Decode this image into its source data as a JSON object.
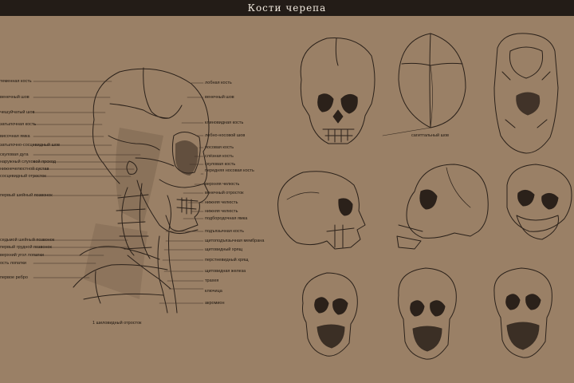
{
  "title": "Кости черепа",
  "labels_left": [
    "теменная кость",
    "венечный шов",
    "чешуйчатый шов",
    "затылочная кость",
    "височная ямка",
    "затылочно-сосцевидный шов",
    "скуловая дуга",
    "наружный слуховой проход",
    "нижнечелюстной сустав",
    "сосцевидный отросток",
    "первый шейный позвонок",
    "седьмой шейный позвонок",
    "первый грудной позвонок",
    "верхний угол лопатки",
    "ость лопатки",
    "первое ребро"
  ],
  "labels_right": [
    "лобная кость",
    "венечный шов",
    "клиновидная кость",
    "лобно-носовой шов",
    "носовая кость",
    "слёзная кость",
    "скуловая кость",
    "передняя носовая кость",
    "верхняя челюсть",
    "венечный отросток",
    "нижняя челюсть",
    "нижняя челюсть",
    "подбородочная ямка",
    "подъязычная кость",
    "щитоподъязычная мембрана",
    "щитовидный хрящ",
    "перстневидный хрящ",
    "щитовидная железа",
    "трахея",
    "ключица",
    "акромион"
  ],
  "footnote": "1 шиловидный отросток",
  "sagittal_label": "сагиттальный шов",
  "colors": {
    "background": "#9a8066",
    "title_bar": "#231c17",
    "title_text": "#f1e9de",
    "ink": "#2b211a",
    "shade": "#7e6650",
    "highlight": "#b09377"
  }
}
